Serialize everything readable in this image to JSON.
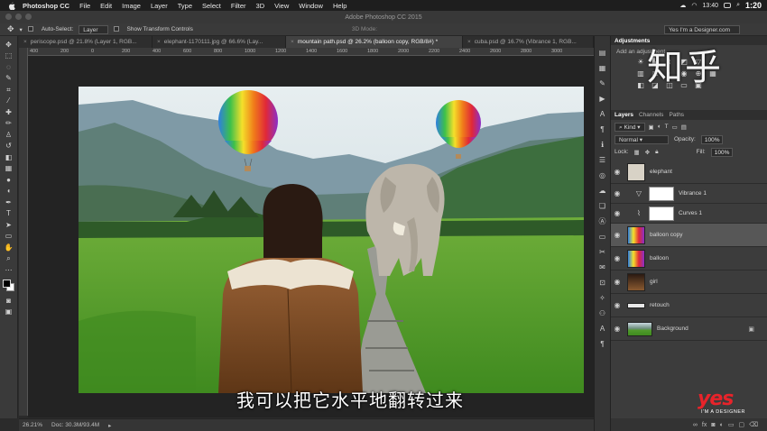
{
  "menubar": {
    "app_name": "Photoshop CC",
    "items": [
      "File",
      "Edit",
      "Image",
      "Layer",
      "Type",
      "Select",
      "Filter",
      "3D",
      "View",
      "Window",
      "Help"
    ],
    "clock": "1:20",
    "battery_time": "13:40"
  },
  "window": {
    "title": "Adobe Photoshop CC 2015"
  },
  "options_bar": {
    "auto_select_label": "Auto-Select:",
    "auto_select_value": "Layer",
    "transform_label": "Show Transform Controls",
    "mode_3d": "3D Mode:",
    "workspace": "Yes I'm a Designer.com"
  },
  "tabs": [
    {
      "label": "periscope.psd @ 21.8% (Layer 1, RGB..."
    },
    {
      "label": "elephant-1170111.jpg @ 66.6% (Lay..."
    },
    {
      "label": "mountain path.psd @ 26.2% (balloon copy, RGB/8#) *"
    },
    {
      "label": "cuba.psd @ 16.7% (Vibrance 1, RGB..."
    }
  ],
  "ruler_ticks": [
    "400",
    "200",
    "0",
    "200",
    "400",
    "600",
    "800",
    "1000",
    "1200",
    "1400",
    "1600",
    "1800",
    "2000",
    "2200",
    "2400",
    "2600",
    "2800",
    "3000"
  ],
  "caption": "我可以把它水平地翻转过来",
  "status": {
    "zoom": "26.21%",
    "doc": "Doc: 30.3M/93.4M"
  },
  "panels": {
    "adjustments_tab": "Adjustments",
    "adjustments_sub": "Add an adjustment",
    "watermark": "知乎",
    "layers_tabs": [
      "Layers",
      "Channels",
      "Paths"
    ],
    "kind_label": "Kind",
    "blend_mode": "Normal",
    "opacity_label": "Opacity:",
    "opacity_value": "100%",
    "lock_label": "Lock:",
    "fill_label": "Fill:",
    "fill_value": "100%"
  },
  "layers": [
    {
      "name": "elephant"
    },
    {
      "name": "Vibrance 1"
    },
    {
      "name": "Curves 1"
    },
    {
      "name": "balloon copy"
    },
    {
      "name": "balloon"
    },
    {
      "name": "girl"
    },
    {
      "name": "retouch"
    },
    {
      "name": "Background"
    }
  ],
  "brand": {
    "logo": "yes",
    "tagline": "I'M A DESIGNER"
  }
}
